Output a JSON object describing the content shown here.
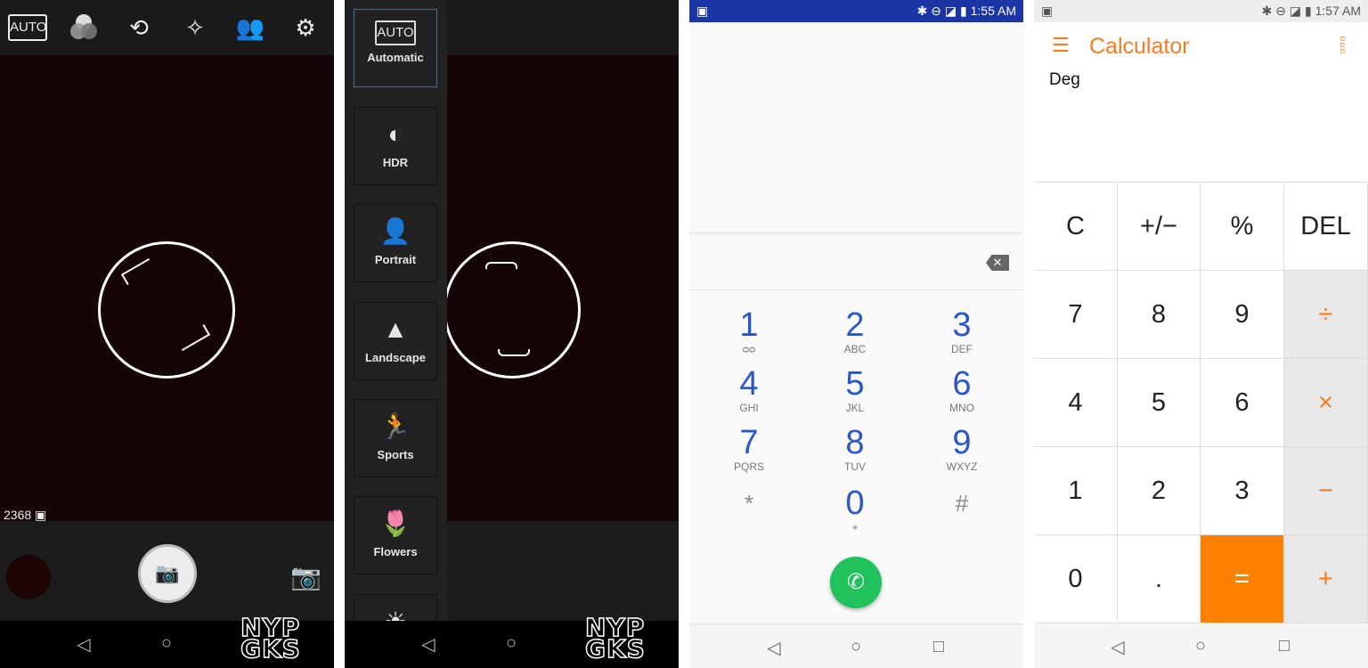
{
  "camera": {
    "auto_label": "AUTO",
    "photo_count": "2368",
    "top_icons": [
      "auto-mode-icon",
      "color-filter-icon",
      "switch-camera-icon",
      "beauty-face-icon",
      "dual-profile-icon",
      "gear-icon"
    ],
    "watermark": [
      "NYP",
      "GKS"
    ]
  },
  "scene_modes": {
    "items": [
      {
        "label": "Automatic",
        "icon": "AUTO",
        "selected": true
      },
      {
        "label": "HDR",
        "icon": "◐"
      },
      {
        "label": "Portrait",
        "icon": "👤"
      },
      {
        "label": "Landscape",
        "icon": "▲"
      },
      {
        "label": "Sports",
        "icon": "🏃"
      },
      {
        "label": "Flowers",
        "icon": "🌷"
      },
      {
        "label": "",
        "icon": "☀"
      }
    ]
  },
  "dialer": {
    "status_time": "1:55 AM",
    "status_color": "#1a35a6",
    "keys": [
      {
        "d": "1",
        "l": "ᴑᴑ"
      },
      {
        "d": "2",
        "l": "ABC"
      },
      {
        "d": "3",
        "l": "DEF"
      },
      {
        "d": "4",
        "l": "GHI"
      },
      {
        "d": "5",
        "l": "JKL"
      },
      {
        "d": "6",
        "l": "MNO"
      },
      {
        "d": "7",
        "l": "PQRS"
      },
      {
        "d": "8",
        "l": "TUV"
      },
      {
        "d": "9",
        "l": "WXYZ"
      },
      {
        "d": "*",
        "l": ""
      },
      {
        "d": "0",
        "l": "+"
      },
      {
        "d": "#",
        "l": ""
      }
    ],
    "call_color": "#1fc25b"
  },
  "calculator": {
    "status_time": "1:57 AM",
    "title": "Calculator",
    "mode": "Deg",
    "accent": "#f47c20",
    "keys": [
      "C",
      "+/−",
      "%",
      "DEL",
      "7",
      "8",
      "9",
      "÷",
      "4",
      "5",
      "6",
      "×",
      "1",
      "2",
      "3",
      "−",
      "0",
      ".",
      "=",
      "+"
    ]
  },
  "nav": {
    "back": "◁",
    "home": "○",
    "recents": "□"
  }
}
